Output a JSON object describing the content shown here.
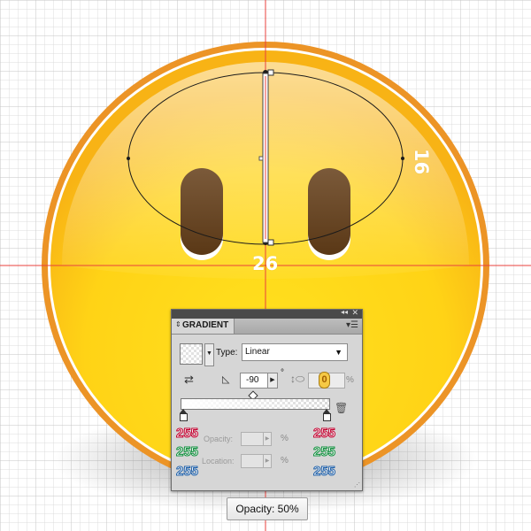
{
  "dimensions": {
    "height_label": "16",
    "width_label": "26"
  },
  "panel": {
    "title": "GRADIENT",
    "type_label": "Type:",
    "type_value": "Linear",
    "angle_value": "-90",
    "degree_symbol": "°",
    "aspect_cursor": "0",
    "aspect_unit": "%",
    "left_stop": {
      "r": "255",
      "g": "255",
      "b": "255"
    },
    "right_stop": {
      "r": "255",
      "g": "255",
      "b": "255"
    },
    "opacity_label": "Opacity:",
    "location_label": "Location:",
    "percent": "%"
  },
  "tooltip": {
    "text": "Opacity: 50%"
  },
  "colors": {
    "face_yellow": "#ffd617",
    "face_outer_ring": "#ec9426",
    "eye_brown": "#5e3b1c",
    "guide_red": "#e8413c",
    "rgb_red": "#c3002f",
    "rgb_green": "#0e8f3c",
    "rgb_blue": "#1e5fa8"
  }
}
